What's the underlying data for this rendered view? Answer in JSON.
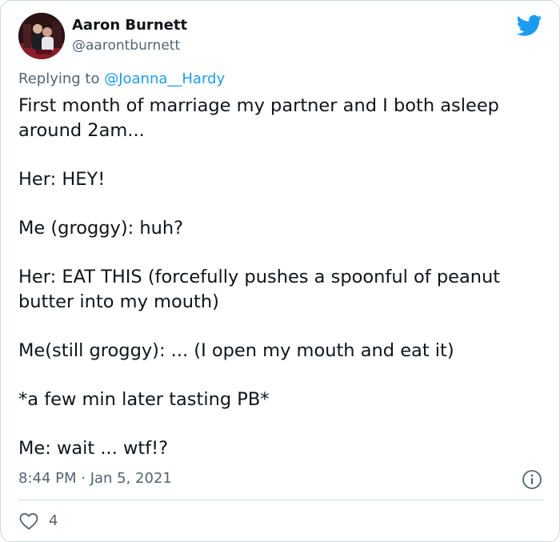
{
  "author": {
    "name": "Aaron Burnett",
    "handle": "@aarontburnett"
  },
  "reply": {
    "prefix": "Replying to ",
    "mention": "@Joanna__Hardy"
  },
  "tweet": {
    "lines": [
      "First month of marriage my partner and I both asleep around 2am...",
      "Her: HEY!",
      "Me (groggy): huh?",
      "Her: EAT THIS (forcefully pushes a spoonful of peanut butter into my mouth)",
      "Me(still groggy): ... (I open my mouth and eat it)",
      "*a few min later tasting PB*",
      "Me: wait ... wtf!?"
    ]
  },
  "meta": {
    "timestamp": "8:44 PM · Jan 5, 2021"
  },
  "actions": {
    "like_count": "4"
  },
  "colors": {
    "brand": "#1d9bf0",
    "text": "#0f1419",
    "muted": "#536471",
    "border": "#cfd9de"
  },
  "icons": {
    "brand": "twitter-bird-icon",
    "info": "info-icon",
    "like": "heart-icon"
  }
}
